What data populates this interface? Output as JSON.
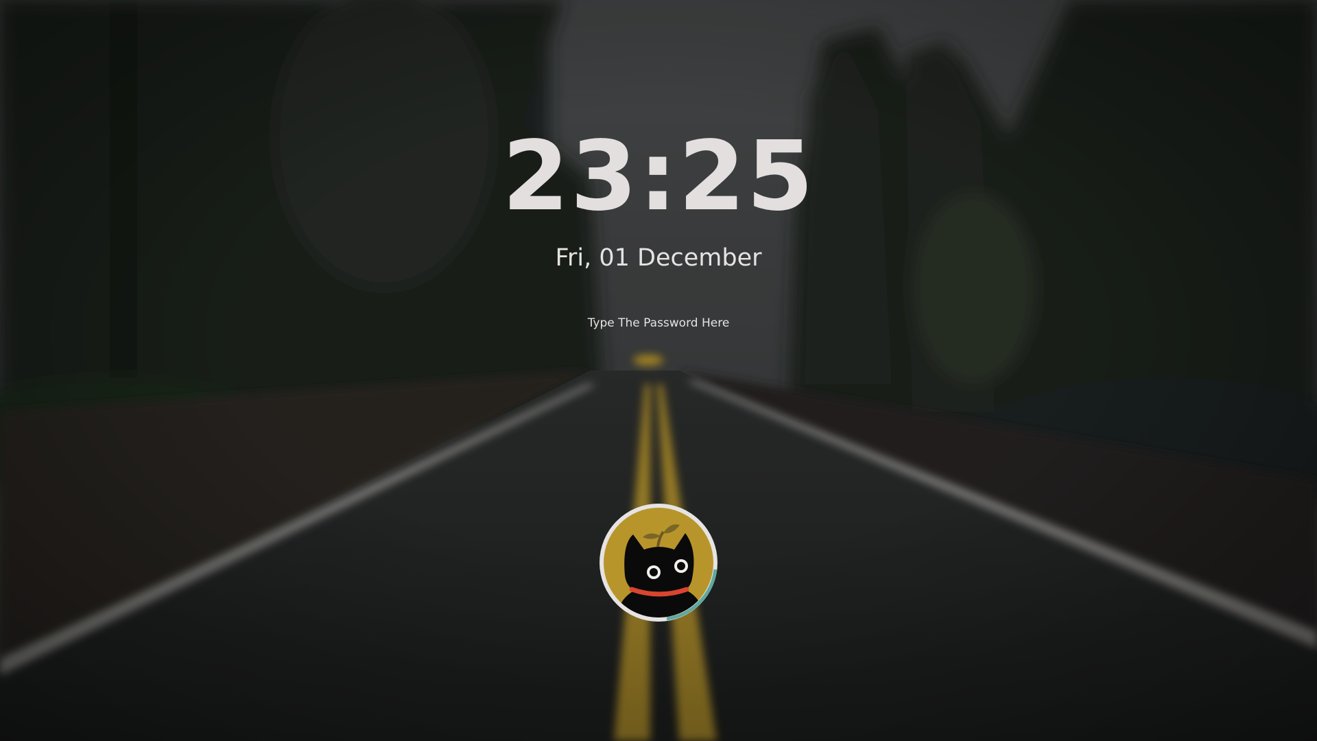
{
  "clock": {
    "time": "23:25"
  },
  "date": {
    "text": "Fri, 01 December"
  },
  "password": {
    "placeholder": "Type The Password Here",
    "value": ""
  },
  "avatar": {
    "icon": "black-cat-avatar",
    "background_color": "#b8952a",
    "ring_color": "#e6e3e3",
    "progress_ring_color": "#5fa8a0"
  },
  "theme": {
    "text_color": "#e3dfdf",
    "road_line_color": "#c9a227"
  }
}
